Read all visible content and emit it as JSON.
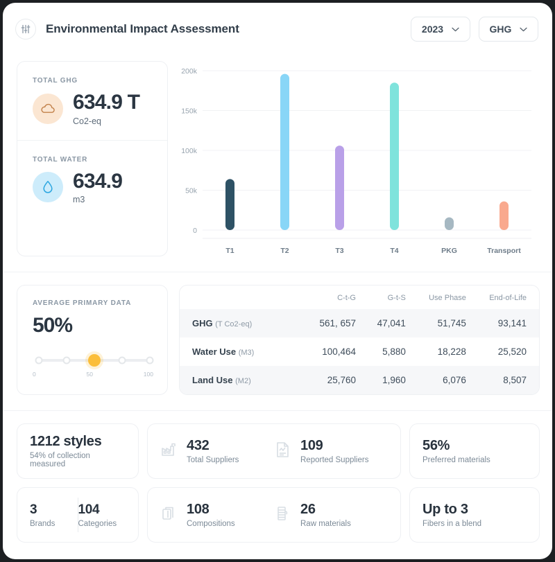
{
  "header": {
    "icon": "sliders-icon",
    "title": "Environmental Impact Assessment",
    "year_dropdown": "2023",
    "metric_dropdown": "GHG"
  },
  "kpis": [
    {
      "label": "TOTAL GHG",
      "value": "634.9 T",
      "unit": "Co2-eq",
      "icon": "cloud-icon",
      "badge_color": "#fbe6d2",
      "icon_color": "#c98a4e"
    },
    {
      "label": "TOTAL WATER",
      "value": "634.9",
      "unit": "m3",
      "icon": "water-drop-icon",
      "badge_color": "#cdecfb",
      "icon_color": "#33a8e0"
    }
  ],
  "chart_data": {
    "type": "bar",
    "title": "",
    "xlabel": "",
    "ylabel": "",
    "categories": [
      "T1",
      "T2",
      "T3",
      "T4",
      "PKG",
      "Transport"
    ],
    "values": [
      64000,
      196000,
      106000,
      185000,
      16000,
      36000
    ],
    "colors": [
      "#2e5265",
      "#89d6f7",
      "#b9a0e8",
      "#7fe3dc",
      "#a6b8c2",
      "#f9a98e"
    ],
    "ylim": [
      0,
      200000
    ],
    "ytick_labels": [
      "0",
      "50k",
      "100k",
      "150k",
      "200k"
    ],
    "ytick_values": [
      0,
      50000,
      100000,
      150000,
      200000
    ],
    "grid": true,
    "legend": "none"
  },
  "primary_data": {
    "label": "AVERAGE PRIMARY DATA",
    "value": "50%",
    "slider_percent": 50,
    "slider_steps": 5,
    "active_step": 2,
    "scale_min": "0",
    "scale_mid": "50",
    "scale_max": "100",
    "accent_color": "#fbbe3a"
  },
  "impact_table": {
    "columns": [
      "",
      "C-t-G",
      "G-t-S",
      "Use Phase",
      "End-of-Life"
    ],
    "rows": [
      {
        "name": "GHG",
        "unit": "(T Co2-eq)",
        "values": [
          "561, 657",
          "47,041",
          "51,745",
          "93,141"
        ],
        "shaded": true
      },
      {
        "name": "Water Use",
        "unit": "(M3)",
        "values": [
          "100,464",
          "5,880",
          "18,228",
          "25,520"
        ],
        "shaded": false
      },
      {
        "name": "Land Use",
        "unit": "(M2)",
        "values": [
          "25,760",
          "1,960",
          "6,076",
          "8,507"
        ],
        "shaded": true
      }
    ]
  },
  "stat_rows": [
    {
      "cards": [
        {
          "kind": "single-noicon",
          "blocks": [
            {
              "num": "1212 styles",
              "sub": "54% of collection measured",
              "icon": null
            }
          ]
        },
        {
          "kind": "double",
          "blocks": [
            {
              "num": "432",
              "sub": "Total Suppliers",
              "icon": "factory-icon"
            },
            {
              "num": "109",
              "sub": "Reported Suppliers",
              "icon": "report-document-icon"
            }
          ]
        },
        {
          "kind": "single-noicon",
          "blocks": [
            {
              "num": "56%",
              "sub": "Preferred materials",
              "icon": null
            }
          ]
        }
      ]
    },
    {
      "cards": [
        {
          "kind": "split",
          "blocks": [
            {
              "num": "3",
              "sub": "Brands",
              "icon": null
            },
            {
              "num": "104",
              "sub": "Categories",
              "icon": null
            }
          ]
        },
        {
          "kind": "double",
          "blocks": [
            {
              "num": "108",
              "sub": "Compositions",
              "icon": "layers-icon"
            },
            {
              "num": "26",
              "sub": "Raw materials",
              "icon": "spool-icon"
            }
          ]
        },
        {
          "kind": "single-noicon",
          "blocks": [
            {
              "num": "Up to 3",
              "sub": "Fibers in a blend",
              "icon": null
            }
          ]
        }
      ]
    }
  ]
}
